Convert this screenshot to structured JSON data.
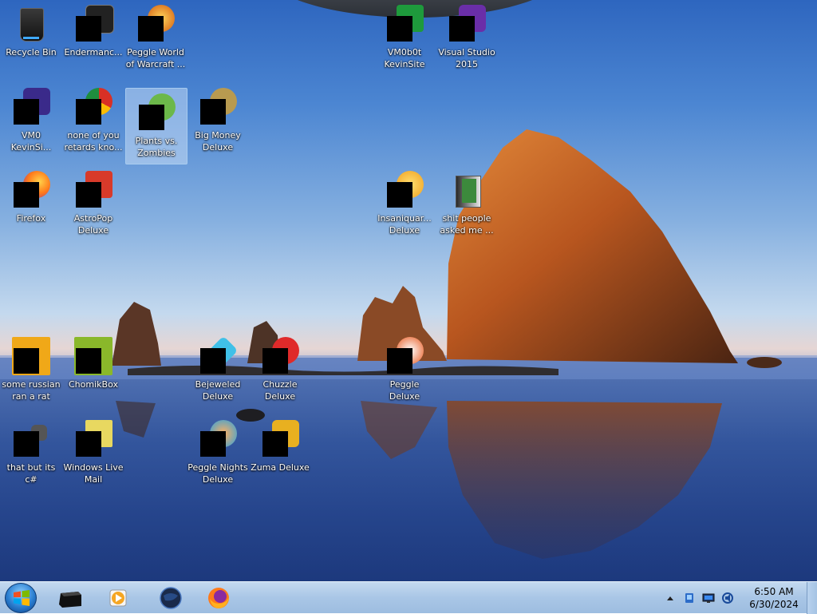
{
  "desktop": {
    "icons": [
      {
        "label": "Recycle Bin",
        "icon": "recycle-bin-icon"
      },
      {
        "label": "Endermanc...",
        "icon": "terminal-icon"
      },
      {
        "label": "Peggle World\nof Warcraft ...",
        "icon": "peggle-world-of-warcraft-icon"
      },
      {
        "label": "VM0b0t\nKevinSite",
        "icon": "shortcut-icon"
      },
      {
        "label": "Visual Studio\n2015",
        "icon": "visual-studio-icon"
      },
      {
        "label": "VM0\nKevinSi...",
        "icon": "shortcut-icon"
      },
      {
        "label": "none of you\nretards kno...",
        "icon": "chrome-icon"
      },
      {
        "label": "Plants vs.\nZombies",
        "icon": "plants-vs-zombies-icon"
      },
      {
        "label": "Big Money\nDeluxe",
        "icon": "big-money-icon"
      },
      {
        "label": "Firefox",
        "icon": "firefox-icon"
      },
      {
        "label": "AstroPop\nDeluxe",
        "icon": "astropop-icon"
      },
      {
        "label": "Insaniquar...\nDeluxe",
        "icon": "insaniquarium-icon"
      },
      {
        "label": "shit people\nasked me ...",
        "icon": "folder-icon"
      },
      {
        "label": "some russian\nran a rat",
        "icon": "file-icon"
      },
      {
        "label": "ChomikBox",
        "icon": "chomikbox-icon"
      },
      {
        "label": "Bejeweled\nDeluxe",
        "icon": "bejeweled-icon"
      },
      {
        "label": "Chuzzle\nDeluxe",
        "icon": "chuzzle-icon"
      },
      {
        "label": "Peggle Deluxe",
        "icon": "peggle-icon"
      },
      {
        "label": "that but its c#",
        "icon": "file-icon"
      },
      {
        "label": "Windows Live\nMail",
        "icon": "windows-live-mail-icon"
      },
      {
        "label": "Peggle Nights\nDeluxe",
        "icon": "peggle-nights-icon"
      },
      {
        "label": "Zuma Deluxe",
        "icon": "zuma-icon"
      }
    ]
  },
  "taskbar": {
    "pinned": [
      {
        "name": "taskbar-cmd-button",
        "icon": "terminal-icon"
      },
      {
        "name": "taskbar-media-player-button",
        "icon": "media-player-icon"
      },
      {
        "name": "taskbar-globe-button",
        "icon": "globe-icon"
      },
      {
        "name": "taskbar-firefox-button",
        "icon": "firefox-icon"
      }
    ],
    "clock": {
      "time": "6:50 AM",
      "date": "6/30/2024"
    }
  },
  "colors": {
    "taskbar": "#a9c6e6",
    "label_text": "#ffffff",
    "selection": "#dcebfc"
  }
}
